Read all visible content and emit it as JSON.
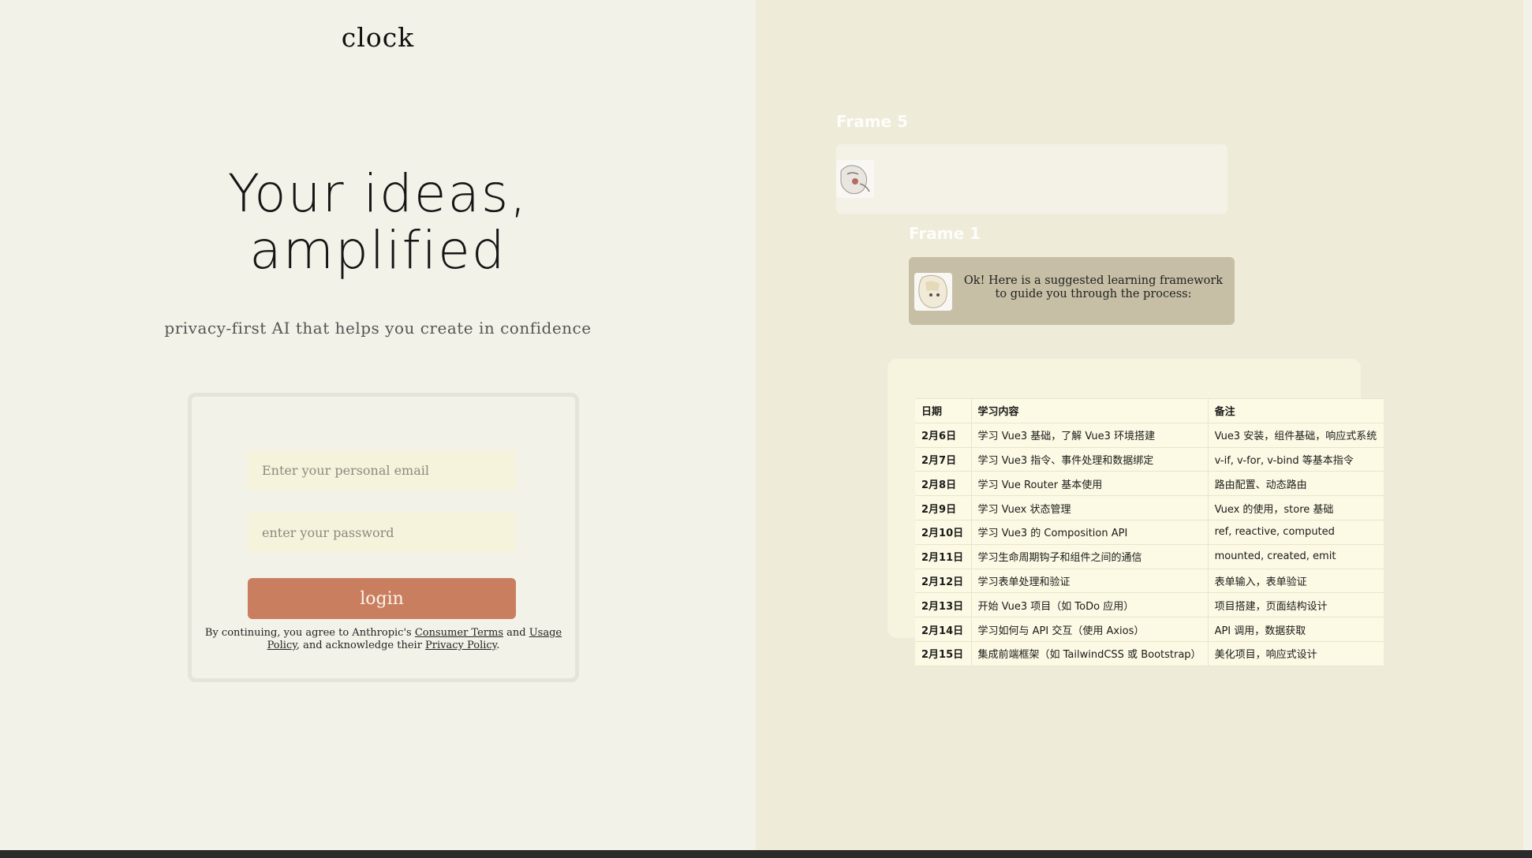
{
  "brand": {
    "logo": "clock"
  },
  "hero": {
    "headline_line1": "Your ideas,",
    "headline_line2": "amplified",
    "subtitle": "privacy-first AI that helps you create in confidence"
  },
  "login_form": {
    "email_placeholder": "Enter your personal email",
    "password_placeholder": "enter your password",
    "login_label": "login",
    "legal": {
      "prefix": "By continuing, you agree to Anthropic's ",
      "consumer_terms": "Consumer Terms",
      "and": " and ",
      "usage_policy": "Usage Policy",
      "middle": ", and acknowledge their ",
      "privacy_policy": "Privacy Policy",
      "suffix": "."
    }
  },
  "canvas": {
    "frame5_label": "Frame 5",
    "frame1_label": "Frame 1",
    "frame1_message": "Ok! Here is a suggested learning framework to guide you through the process:"
  },
  "schedule": {
    "headers": [
      "日期",
      "学习内容",
      "备注"
    ],
    "rows": [
      [
        "2月6日",
        "学习 Vue3 基础，了解 Vue3 环境搭建",
        "Vue3 安装，组件基础，响应式系统"
      ],
      [
        "2月7日",
        "学习 Vue3 指令、事件处理和数据绑定",
        "v-if, v-for, v-bind 等基本指令"
      ],
      [
        "2月8日",
        "学习 Vue Router 基本使用",
        "路由配置、动态路由"
      ],
      [
        "2月9日",
        "学习 Vuex 状态管理",
        "Vuex 的使用，store 基础"
      ],
      [
        "2月10日",
        "学习 Vue3 的 Composition API",
        "ref, reactive, computed"
      ],
      [
        "2月11日",
        "学习生命周期钩子和组件之间的通信",
        "mounted, created, emit"
      ],
      [
        "2月12日",
        "学习表单处理和验证",
        "表单输入，表单验证"
      ],
      [
        "2月13日",
        "开始 Vue3 项目（如 ToDo 应用）",
        "项目搭建，页面结构设计"
      ],
      [
        "2月14日",
        "学习如何与 API 交互（使用 Axios）",
        "API 调用，数据获取"
      ],
      [
        "2月15日",
        "集成前端框架（如 TailwindCSS 或 Bootstrap）",
        "美化项目，响应式设计"
      ]
    ]
  },
  "colors": {
    "left_bg": "#f3f2e8",
    "right_bg": "#eeebd9",
    "button": "#c97f5f",
    "input_bg": "#f6f3dc",
    "frame1_bg": "#c6bfa5"
  }
}
